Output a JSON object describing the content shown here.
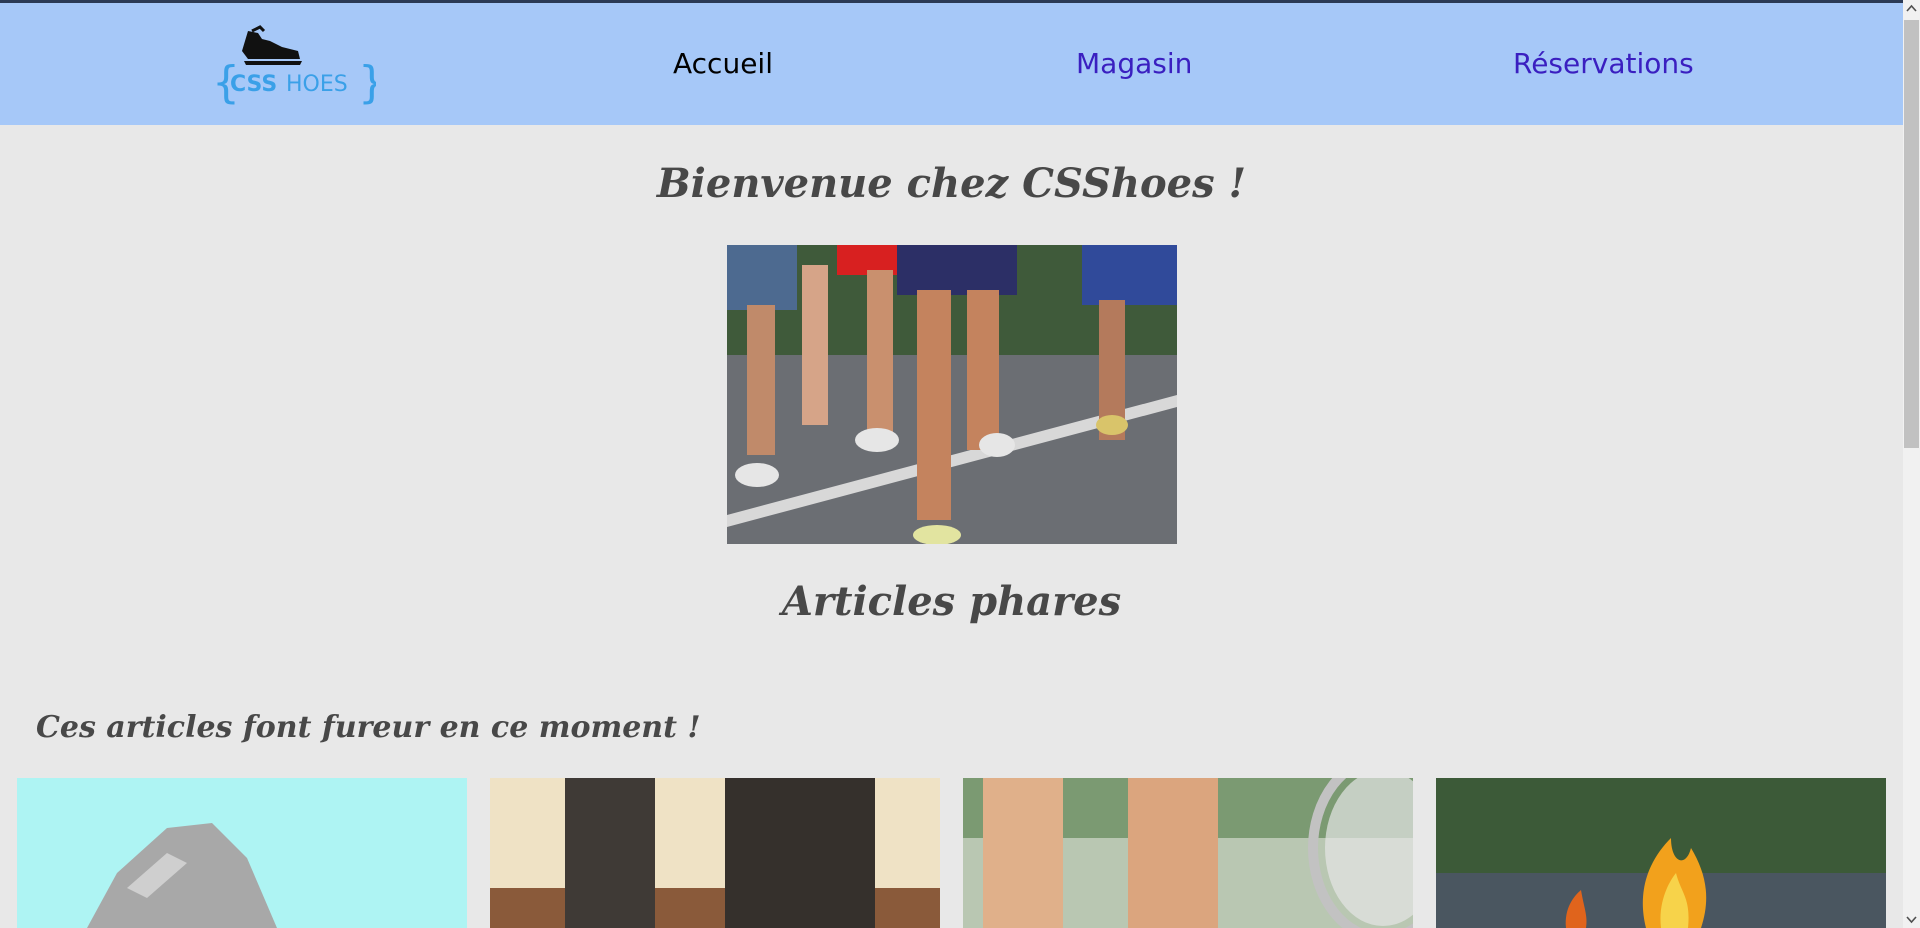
{
  "site": {
    "logo_text_css": "CSS",
    "logo_text_shoes": "HOES",
    "logo_brace_left": "{",
    "logo_brace_right": "}"
  },
  "nav": {
    "home": "Accueil",
    "shop": "Magasin",
    "reservations": "Réservations"
  },
  "main": {
    "welcome": "Bienvenue chez CSShoes !",
    "featured": "Articles phares",
    "trending": "Ces articles font fureur en ce moment !"
  },
  "colors": {
    "nav_bg": "#a6c8f8",
    "page_bg": "#e8e8e8",
    "link_active": "#000000",
    "link": "#3a1fc0",
    "heading": "#484848",
    "logo_blue": "#3aa0e8"
  },
  "icons": {
    "scroll_up": "chevron-up-icon",
    "scroll_down": "chevron-down-icon"
  }
}
